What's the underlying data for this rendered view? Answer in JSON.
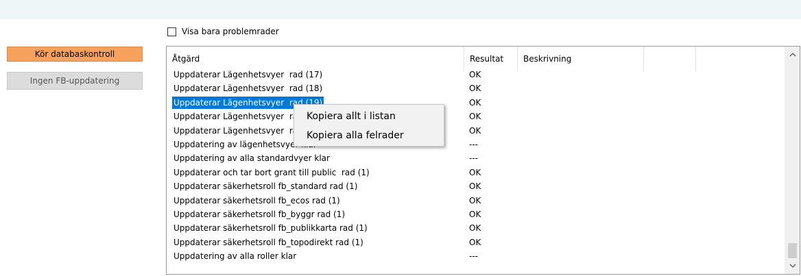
{
  "filter": {
    "only_problem_rows_label": "Visa bara problemrader",
    "checked": false
  },
  "buttons": {
    "run_db_check": "Kör databaskontroll",
    "no_fb_update": "Ingen FB-uppdatering"
  },
  "columns": {
    "action": "Åtgärd",
    "result": "Resultat",
    "description": "Beskrivning",
    "extra1": "",
    "extra2": ""
  },
  "rows": [
    {
      "action": "Uppdaterar Lägenhetsvyer  rad (17)",
      "result": "OK"
    },
    {
      "action": "Uppdaterar Lägenhetsvyer  rad (18)",
      "result": "OK"
    },
    {
      "action": "Uppdaterar Lägenhetsvyer  rad (19)",
      "result": "OK",
      "selected": true
    },
    {
      "action": "Uppdaterar Lägenhetsvyer  rad (20)",
      "result": "OK"
    },
    {
      "action": "Uppdaterar Lägenhetsvyer  rad (21)",
      "result": "OK"
    },
    {
      "action": "Uppdatering av lägenhetsvyer klar",
      "result": "---"
    },
    {
      "action": "Uppdatering av alla standardvyer klar",
      "result": "---"
    },
    {
      "action": "Uppdaterar och tar bort grant till public  rad (1)",
      "result": "OK"
    },
    {
      "action": "Uppdaterar säkerhetsroll fb_standard rad (1)",
      "result": "OK"
    },
    {
      "action": "Uppdaterar säkerhetsroll fb_ecos rad (1)",
      "result": "OK"
    },
    {
      "action": "Uppdaterar säkerhetsroll fb_byggr rad (1)",
      "result": "OK"
    },
    {
      "action": "Uppdaterar säkerhetsroll fb_publikkarta rad (1)",
      "result": "OK"
    },
    {
      "action": "Uppdaterar säkerhetsroll fb_topodirekt rad (1)",
      "result": "OK"
    },
    {
      "action": "Uppdatering av alla roller klar",
      "result": "---"
    }
  ],
  "context_menu": {
    "copy_all": "Kopiera allt i listan",
    "copy_errors": "Kopiera alla felrader"
  },
  "icons": {
    "scroll_up": "chevron-up-icon",
    "scroll_down": "chevron-down-icon"
  },
  "colors": {
    "run_button": "#f7a25c",
    "selection": "#0078d7",
    "disabled_button": "#dcdcdc"
  }
}
